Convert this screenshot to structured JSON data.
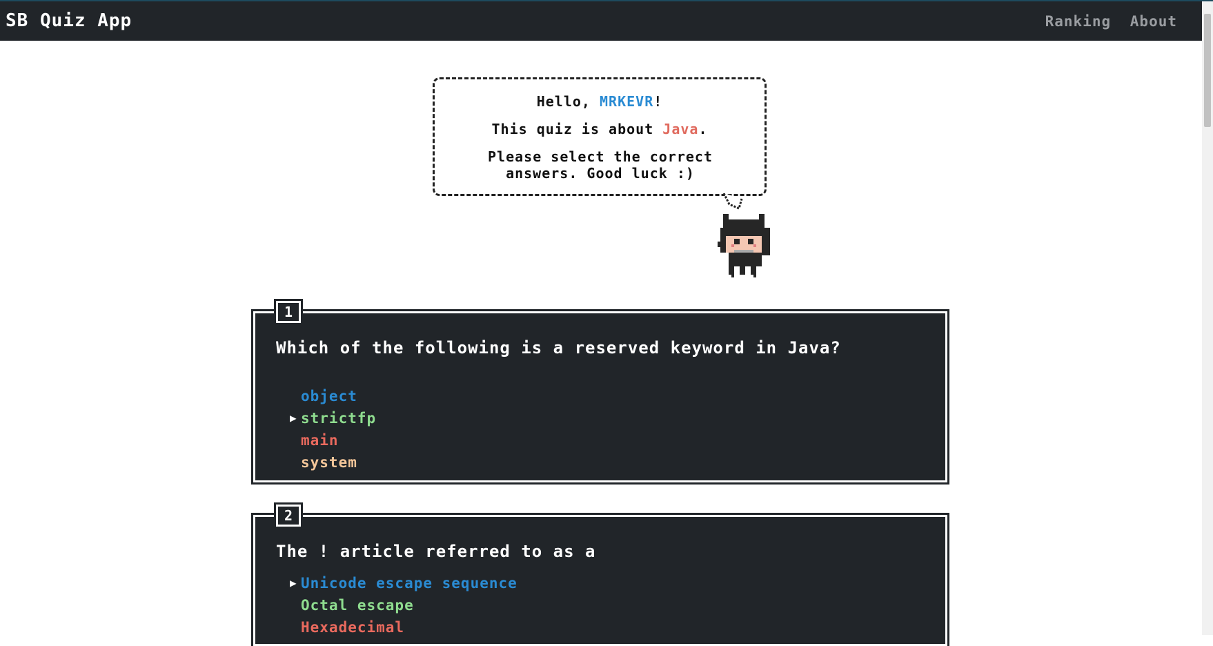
{
  "navbar": {
    "brand": "SB Quiz App",
    "links": [
      {
        "label": "Ranking"
      },
      {
        "label": "About"
      }
    ]
  },
  "greeting": {
    "hello_prefix": "Hello, ",
    "username": "MRKEVR",
    "hello_suffix": "!",
    "topic_prefix": "This quiz is about ",
    "topic": "Java",
    "topic_suffix": ".",
    "instructions": "Please select the correct answers. Good luck :)"
  },
  "questions": [
    {
      "number": "1",
      "text": "Which of the following is a reserved keyword in Java?",
      "answers": [
        {
          "label": "object",
          "selected": false
        },
        {
          "label": "strictfp",
          "selected": true
        },
        {
          "label": "main",
          "selected": false
        },
        {
          "label": "system",
          "selected": false
        }
      ]
    },
    {
      "number": "2",
      "text": "The ! article referred to as a",
      "answers": [
        {
          "label": "Unicode escape sequence",
          "selected": true
        },
        {
          "label": "Octal escape",
          "selected": false
        },
        {
          "label": "Hexadecimal",
          "selected": false
        }
      ]
    }
  ],
  "colors": {
    "navbar_bg": "#212529",
    "answer_1": "#2a8bd3",
    "answer_2": "#8fdc8f",
    "answer_3": "#ea6a5e",
    "answer_4": "#f5c79a"
  },
  "icons": {
    "selection_marker": "triangle-right-icon",
    "mascot": "cat-mascot-icon"
  }
}
